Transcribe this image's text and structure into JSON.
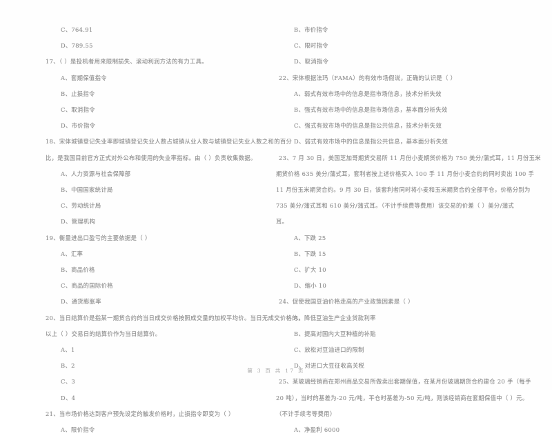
{
  "document": {
    "kind": "scanned-exam-page",
    "footer": "第 3 页 共 17 页"
  },
  "left_column": {
    "lines": [
      {
        "type": "opt",
        "text": "C、764.91"
      },
      {
        "type": "opt",
        "text": "D、789.55"
      },
      {
        "type": "q",
        "text": "17、（      ）是投机者用来限制损失、滚动利润方法的有力工具。"
      },
      {
        "type": "opt",
        "text": "A、套期保值指令"
      },
      {
        "type": "opt",
        "text": "B、止损指令"
      },
      {
        "type": "opt",
        "text": "C、取消指令"
      },
      {
        "type": "opt",
        "text": "D、市价指令"
      },
      {
        "type": "q",
        "text": "18、宋体城镇登记失业率即城镇登记失业人数占城镇从业人数与城镇登记失业人数之和的百分"
      },
      {
        "type": "cont",
        "text": "比，是我国目前官方正式对外公布和使用的失业率指标。由（      ）负责收集数据。"
      },
      {
        "type": "opt",
        "text": "A、人力资源与社会保障部"
      },
      {
        "type": "opt",
        "text": "B、中国国家统计局"
      },
      {
        "type": "opt",
        "text": "C、劳动统计局"
      },
      {
        "type": "opt",
        "text": "D、管理机构"
      },
      {
        "type": "q",
        "text": "19、衡量进出口盈亏的主要依据是（      ）"
      },
      {
        "type": "opt",
        "text": "A、汇率"
      },
      {
        "type": "opt",
        "text": "B、商品价格"
      },
      {
        "type": "opt",
        "text": "C、商品的国际价格"
      },
      {
        "type": "opt",
        "text": "D、通货膨胀率"
      },
      {
        "type": "q",
        "text": "20、当日结算价是指某一期货合约的当日成交价格按照成交量的加权平均价。当日无成交价格的，"
      },
      {
        "type": "cont",
        "text": "以上（      ）交易日的结算价作为当日结算价。"
      },
      {
        "type": "opt",
        "text": "A、1"
      },
      {
        "type": "opt",
        "text": "B、2"
      },
      {
        "type": "opt",
        "text": "C、3"
      },
      {
        "type": "opt",
        "text": "D、4"
      },
      {
        "type": "q",
        "text": "21、当市场价格达到客户预先设定的触发价格时，止损指令即变为（       ）"
      },
      {
        "type": "opt",
        "text": "A、限价指令"
      }
    ]
  },
  "right_column": {
    "lines": [
      {
        "type": "opt",
        "text": "B、市价指令"
      },
      {
        "type": "opt",
        "text": "C、限时指令"
      },
      {
        "type": "opt",
        "text": "D、取消指令"
      },
      {
        "type": "q",
        "text": "22、宋体根据法玛（FAMA）的有效市场假说，正确的认识是（       ）"
      },
      {
        "type": "opt",
        "text": "A、弱式有效市场中的信息是指市场信息，技术分析失效"
      },
      {
        "type": "opt",
        "text": "B、强式有效市场中的信息是指市场信息，基本面分析失效"
      },
      {
        "type": "opt",
        "text": "C、强式有效市场中的信息是指公共信息，技术分析失效"
      },
      {
        "type": "opt",
        "text": "D、弱式有效市场中的信息是指公共信息，基本面分析失效"
      },
      {
        "type": "q",
        "text": "23、7 月 30 日，美国芝加哥期货交易所 11 月份小麦期货价格为 750 美分/蒲式耳，11 月份玉米"
      },
      {
        "type": "cont",
        "text": "期货价格 635 美分/蒲式耳，套利者按上述价格买入 100 手 11 月份小麦合约的同时卖出 100 手"
      },
      {
        "type": "cont",
        "text": "11 月份玉米期货合约。9 月 30 日，该套利者同时将小麦和玉米期货合约全部平仓，价格分别为"
      },
      {
        "type": "cont",
        "text": "735 美分/蒲式耳和 610 美分/蒲式耳。（不计手续费等费用）该交易的价差（      ）美分/蒲式"
      },
      {
        "type": "cont",
        "text": "耳。"
      },
      {
        "type": "opt",
        "text": "A、下跌 25"
      },
      {
        "type": "opt",
        "text": "B、下跌 15"
      },
      {
        "type": "opt",
        "text": "C、扩大 10"
      },
      {
        "type": "opt",
        "text": "D、缩小 10"
      },
      {
        "type": "q",
        "text": "24、促使我国豆油价格走高的产业政策因素是（       ）"
      },
      {
        "type": "opt",
        "text": "A、降低豆油生产企业贷款利率"
      },
      {
        "type": "opt",
        "text": "B、提高对国内大豆种植的补贴"
      },
      {
        "type": "opt",
        "text": "C、放松对豆油进口的限制"
      },
      {
        "type": "opt",
        "text": "D、对进口大豆征收高关税"
      },
      {
        "type": "q",
        "text": "25、某玻璃经销商在郑州商品交易所做卖出套期保值，在某月份玻璃期货合约建仓 20 手（每手"
      },
      {
        "type": "cont",
        "text": "20 吨），当时的基差为-20 元/吨，平仓时基差为-50 元/吨，则该经销商在套期保值中（      ）元。"
      },
      {
        "type": "cont",
        "text": "（不计手续考等费用）"
      },
      {
        "type": "opt",
        "text": "A、净盈利 6000"
      }
    ]
  }
}
